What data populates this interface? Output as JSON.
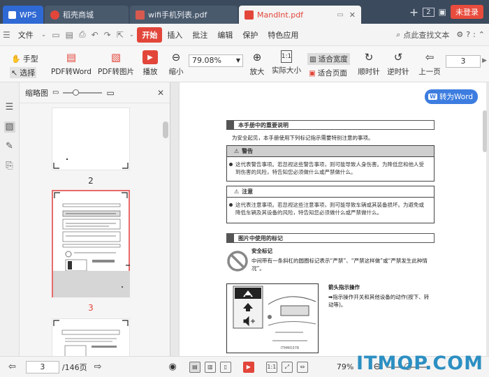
{
  "tabs": {
    "wps": "WPS",
    "daoke": "稻壳商城",
    "wifi": "wifi手机列表.pdf",
    "active": "MandInt.pdf",
    "tab_count": "2",
    "login": "未登录"
  },
  "menu": {
    "file": "文件",
    "start": "开始",
    "insert": "插入",
    "annotate": "批注",
    "edit": "编辑",
    "protect": "保护",
    "features": "特色应用",
    "search_placeholder": "点此查找文本"
  },
  "toolbar": {
    "hand": "手型",
    "select": "选择",
    "pdf_to_word": "PDF转Word",
    "pdf_to_image": "PDF转图片",
    "play": "播放",
    "zoom_out": "缩小",
    "zoom_value": "79.08%",
    "zoom_in": "放大",
    "actual_size": "实际大小",
    "fit_width": "适合宽度",
    "fit_page": "适合页面",
    "rotate_cw": "顺时针",
    "rotate_ccw": "逆时针",
    "prev_page": "上一页",
    "page_value": "3"
  },
  "thumbs": {
    "title": "缩略图",
    "label_2": "2",
    "label_3": "3"
  },
  "doc": {
    "to_word": "转为Word",
    "sec1_title": "本手册中的重要说明",
    "intro": "为安全起见，本手册使用下列标记指示需要特别注意的事项。",
    "warning_title": "警告",
    "warning_body": "这代表警告事项。若忽视这些警告事项，则可能导致人身伤害。为降低您和他人受到伤害的风险，特告知您必须做什么或严禁做什么。",
    "caution_title": "注意",
    "caution_body": "这代表注意事项。若忽视这些注意事项，则可能导致车辆或其装备损坏。为避免或降低车辆及其设备的风险，特告知您必须做什么或严禁做什么。",
    "sec2_title": "图片中使用的标记",
    "safety_title": "安全标记",
    "safety_body": "中间带有一条斜杠的圆圈标记表示“严禁”、“严禁这样做”或“严禁发生此种情况”。",
    "arrow_title": "箭头指示操作",
    "arrow_body": "指示操作开关和其他设备的动作(按下、转动等)。",
    "figure_code": "ITHMO378"
  },
  "status": {
    "page_input": "3",
    "page_total": "/146页",
    "zoom": "79%"
  },
  "watermark": "ITMOP.COM"
}
